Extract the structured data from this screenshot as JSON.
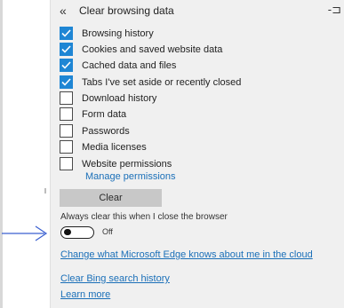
{
  "header": {
    "back_glyph": "«",
    "title": "Clear browsing data",
    "pin_glyph": "-⊐"
  },
  "options": [
    {
      "label": "Browsing history",
      "checked": true
    },
    {
      "label": "Cookies and saved website data",
      "checked": true
    },
    {
      "label": "Cached data and files",
      "checked": true
    },
    {
      "label": "Tabs I've set aside or recently closed",
      "checked": true
    },
    {
      "label": "Download history",
      "checked": false
    },
    {
      "label": "Form data",
      "checked": false
    },
    {
      "label": "Passwords",
      "checked": false
    },
    {
      "label": "Media licenses",
      "checked": false
    },
    {
      "label": "Website permissions",
      "checked": false
    }
  ],
  "manage_permissions_label": "Manage permissions",
  "clear_button_label": "Clear",
  "always_clear": {
    "label": "Always clear this when I close the browser",
    "state_label": "Off",
    "is_on": false
  },
  "links": {
    "edge_knows": "Change what Microsoft Edge knows about me in the cloud",
    "bing_history": "Clear Bing search history",
    "learn_more": "Learn more"
  },
  "colors": {
    "checkbox_checked": "#1f86d4",
    "link": "#1a6fb8",
    "panel_bg": "#f0f0f0",
    "annotation_arrow": "#3a5fd0"
  },
  "icons": {
    "back": "double-chevron-left-icon",
    "pin": "pin-icon",
    "check": "checkmark-icon",
    "annotation": "arrow-right-icon"
  }
}
